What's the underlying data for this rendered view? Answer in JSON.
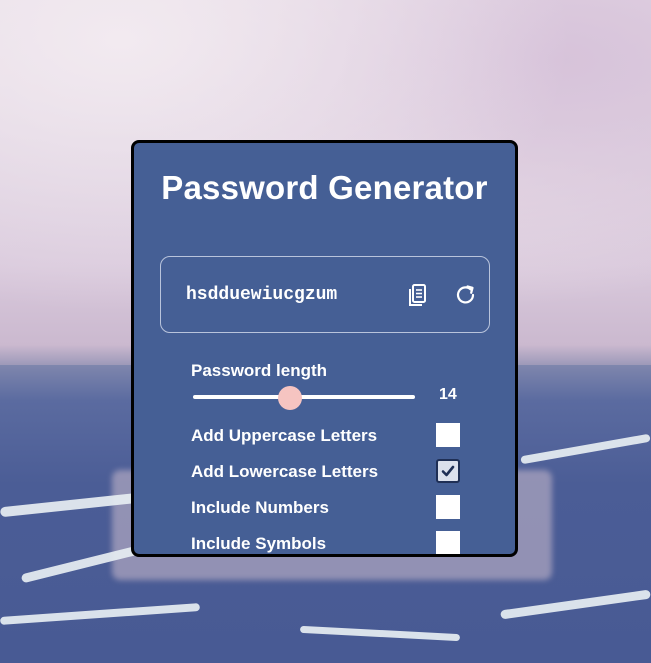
{
  "app": {
    "title": "Password Generator"
  },
  "output": {
    "password": "hsdduewiucgzum",
    "copy_icon": "clipboard-icon",
    "refresh_icon": "refresh-icon"
  },
  "length": {
    "label": "Password length",
    "value": "14",
    "min": 0,
    "max": 32,
    "current": 14
  },
  "options": [
    {
      "label": "Add Uppercase Letters",
      "checked": false
    },
    {
      "label": "Add Lowercase Letters",
      "checked": true
    },
    {
      "label": "Include Numbers",
      "checked": false
    },
    {
      "label": "Include Symbols",
      "checked": false
    }
  ],
  "colors": {
    "card_bg": "#455f95",
    "card_border": "#000000",
    "slider_thumb": "#f6c4c1",
    "text": "#ffffff"
  }
}
